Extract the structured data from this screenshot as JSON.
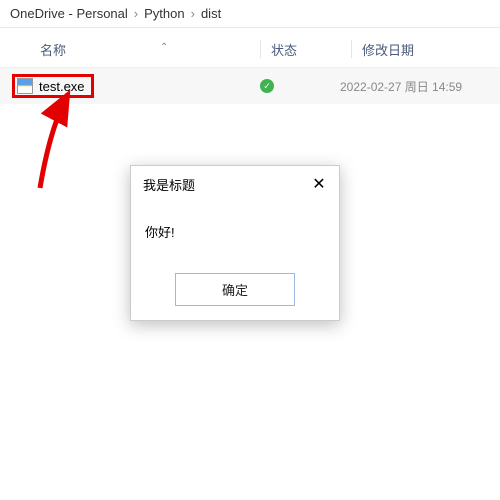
{
  "breadcrumb": {
    "part1": "OneDrive - Personal",
    "part2": "Python",
    "part3": "dist"
  },
  "headers": {
    "name": "名称",
    "status": "状态",
    "modified": "修改日期"
  },
  "file": {
    "name": "test.exe",
    "status_icon": "check",
    "modified": "2022-02-27 周日 14:59"
  },
  "dialog": {
    "title": "我是标题",
    "message": "你好!",
    "ok": "确定"
  },
  "icons": {
    "close": "✕",
    "check": "✓",
    "separator": "›",
    "caret": "⌃"
  }
}
